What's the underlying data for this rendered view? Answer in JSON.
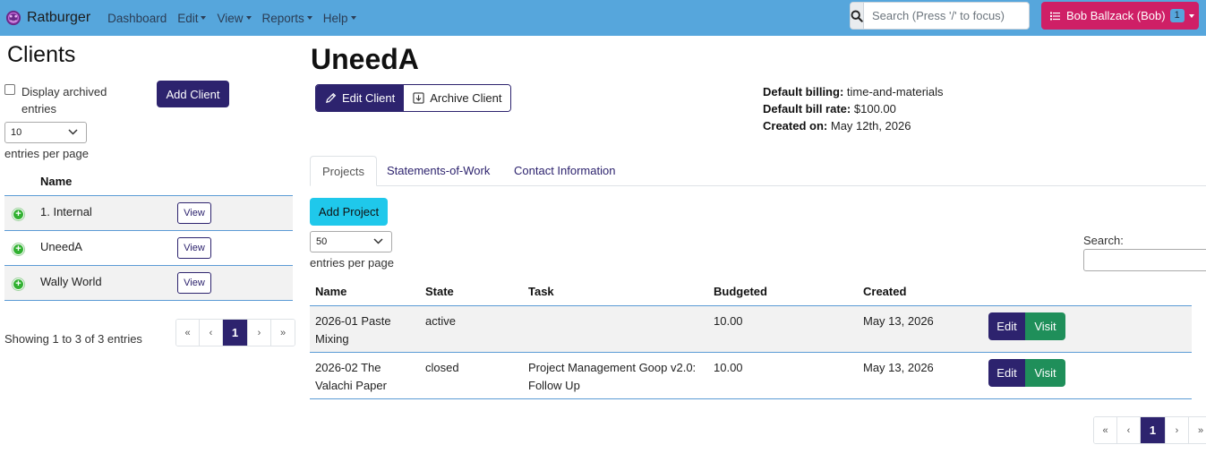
{
  "navbar": {
    "brand": "Ratburger",
    "menu": [
      {
        "label": "Dashboard",
        "dropdown": false
      },
      {
        "label": "Edit",
        "dropdown": true
      },
      {
        "label": "View",
        "dropdown": true
      },
      {
        "label": "Reports",
        "dropdown": true
      },
      {
        "label": "Help",
        "dropdown": true
      }
    ],
    "search_placeholder": "Search (Press '/' to focus)",
    "user_label": "Bob Ballzack (Bob)",
    "user_badge": "1",
    "colors": {
      "navbar": "#56a6dc",
      "user_button": "#cf1f66"
    }
  },
  "sidebar": {
    "title": "Clients",
    "archived_label": "Display archived entries",
    "add_client_label": "Add Client",
    "entries_value": "10",
    "entries_label": "entries per page",
    "column_name": "Name",
    "clients": [
      {
        "name": "1. Internal",
        "action": "View"
      },
      {
        "name": "UneedA",
        "action": "View"
      },
      {
        "name": "Wally World",
        "action": "View"
      }
    ],
    "showing": "Showing 1 to 3 of 3 entries",
    "pager": [
      "«",
      "‹",
      "1",
      "›",
      "»"
    ]
  },
  "client": {
    "name": "UneedA",
    "edit_label": "Edit Client",
    "archive_label": "Archive Client",
    "billing_key": "Default billing:",
    "billing_value": "time-and-materials",
    "rate_key": "Default bill rate:",
    "rate_value": "$100.00",
    "created_key": "Created on:",
    "created_value": "May 12th, 2026"
  },
  "tabs": [
    "Projects",
    "Statements-of-Work",
    "Contact Information"
  ],
  "projects": {
    "add_label": "Add Project",
    "entries_value": "50",
    "entries_label": "entries per page",
    "search_label": "Search:",
    "columns": [
      "Name",
      "State",
      "Task",
      "Budgeted",
      "Created"
    ],
    "rows": [
      {
        "name_line1": "2026-01 Paste",
        "name_line2": "Mixing",
        "state": "active",
        "task_line1": "",
        "task_line2": "",
        "budgeted": "10.00",
        "created": "May 13, 2026",
        "edit": "Edit",
        "visit": "Visit"
      },
      {
        "name_line1": "2026-02 The",
        "name_line2": "Valachi Paper",
        "state": "closed",
        "task_line1": "Project Management Goop v2.0:",
        "task_line2": "Follow Up",
        "budgeted": "10.00",
        "created": "May 13, 2026",
        "edit": "Edit",
        "visit": "Visit"
      }
    ],
    "pager": [
      "«",
      "‹",
      "1",
      "›",
      "»"
    ]
  }
}
